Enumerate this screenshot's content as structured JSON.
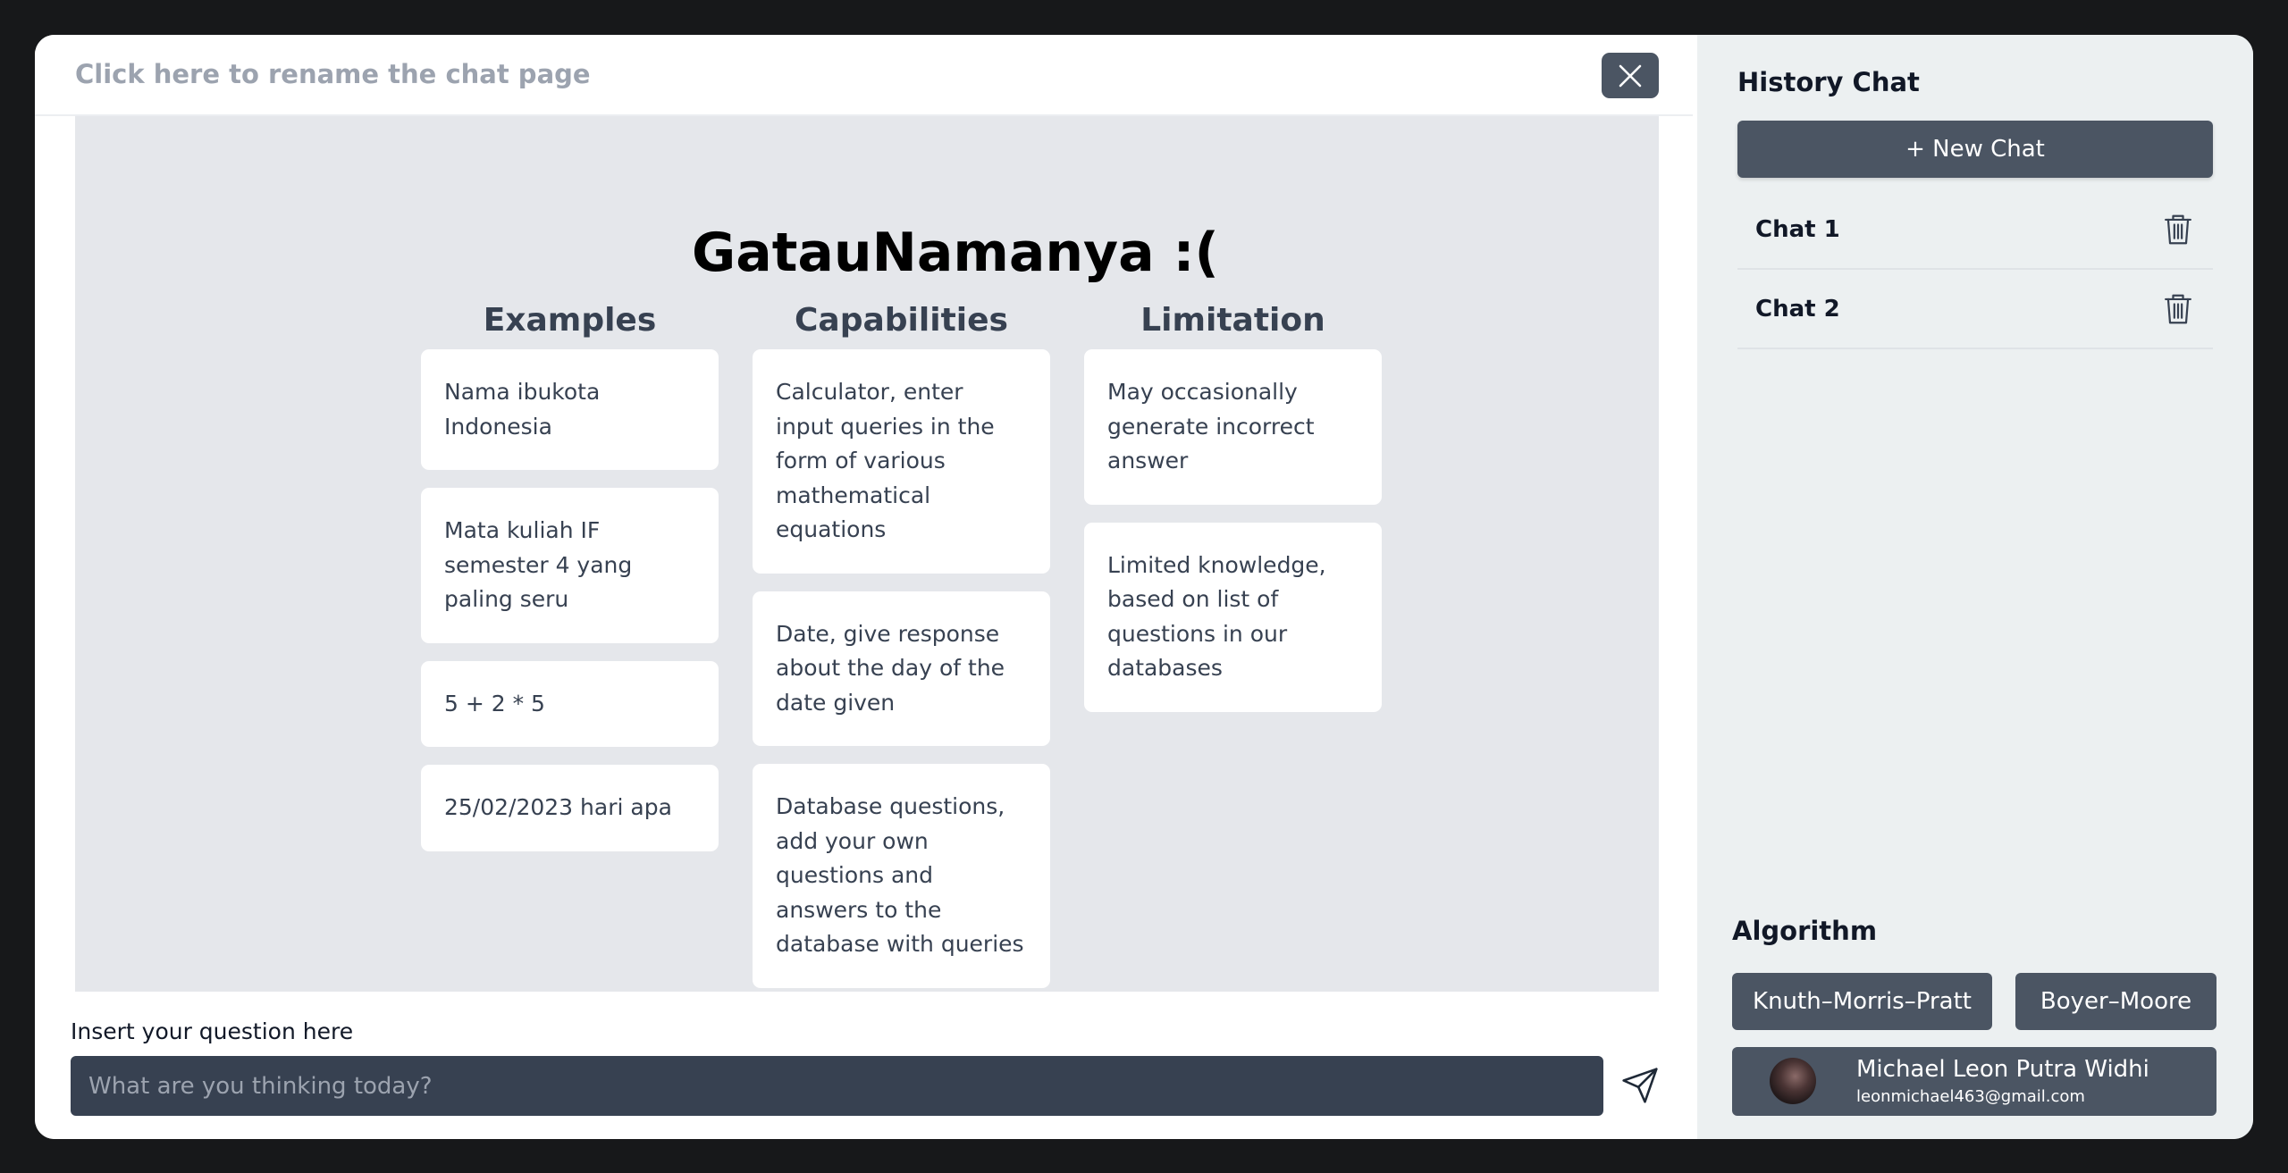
{
  "header": {
    "rename_text": "Click here to rename the chat page"
  },
  "main": {
    "brand": "GatauNamanya :(",
    "columns": [
      {
        "title": "Examples",
        "cards": [
          "Nama ibukota Indonesia",
          "Mata kuliah IF semester 4 yang paling seru",
          "5 + 2 * 5",
          "25/02/2023 hari apa"
        ]
      },
      {
        "title": "Capabilities",
        "cards": [
          "Calculator, enter input queries in the form of various mathematical equations",
          "Date, give response about the day of the date given",
          "Database questions, add your own questions and answers to the database with queries"
        ]
      },
      {
        "title": "Limitation",
        "cards": [
          "May occasionally generate incorrect answer",
          "Limited knowledge, based on list of questions in our databases"
        ]
      }
    ],
    "question_label": "Insert your question here",
    "input_placeholder": "What are you thinking today?"
  },
  "sidebar": {
    "history_title": "History Chat",
    "new_chat_label": "+ New Chat",
    "chats": [
      {
        "label": "Chat 1"
      },
      {
        "label": "Chat 2"
      }
    ],
    "algorithm_title": "Algorithm",
    "algorithms": [
      "Knuth–Morris–Pratt",
      "Boyer–Moore"
    ],
    "profile": {
      "name": "Michael Leon Putra Widhi",
      "email": "leonmichael463@gmail.com"
    }
  },
  "icons": {
    "close": "close-icon",
    "send": "send-icon",
    "delete": "trash-icon"
  },
  "colors": {
    "page_background": "#17181a",
    "content_background": "#e5e7eb",
    "button": "#4b5563",
    "input": "#374151",
    "sidebar": "#ecf0f1"
  }
}
